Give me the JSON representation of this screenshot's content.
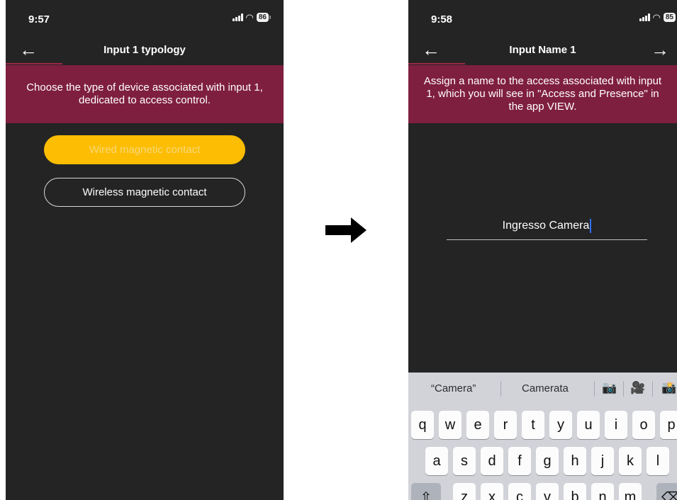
{
  "left_screen": {
    "status": {
      "time": "9:57",
      "battery": "86"
    },
    "nav": {
      "title": "Input 1 typology",
      "back_icon": "←"
    },
    "banner": "Choose the type of device associated with input 1, dedicated to access control.",
    "options": [
      {
        "label": "Wired magnetic contact",
        "selected": true
      },
      {
        "label": "Wireless magnetic contact",
        "selected": false
      }
    ]
  },
  "transition_arrow": "arrow-right-icon",
  "right_screen": {
    "status": {
      "time": "9:58",
      "battery": "85"
    },
    "nav": {
      "title": "Input Name 1",
      "back_icon": "←",
      "forward_icon": "→"
    },
    "banner": "Assign a name to the access associated with input 1, which you will see in \"Access and Presence\" in the app VIEW.",
    "name_input": {
      "value": "Ingresso Camera"
    },
    "keyboard": {
      "suggestions": [
        "“Camera”",
        "Camerata"
      ],
      "emoji": [
        "📷",
        "🎥",
        "📸"
      ],
      "row1": [
        "q",
        "w",
        "e",
        "r",
        "t",
        "y",
        "u",
        "i",
        "o",
        "p"
      ],
      "row2": [
        "a",
        "s",
        "d",
        "f",
        "g",
        "h",
        "j",
        "k",
        "l"
      ],
      "row3": [
        "z",
        "x",
        "c",
        "v",
        "b",
        "n",
        "m"
      ],
      "shift_icon": "⇧",
      "delete_icon": "⌫"
    }
  },
  "colors": {
    "screen_bg": "#242424",
    "banner_bg": "#7f1f3f",
    "accent_yellow": "#fcbd03",
    "keyboard_bg": "#d1d3d9",
    "caret": "#2f6fff"
  }
}
